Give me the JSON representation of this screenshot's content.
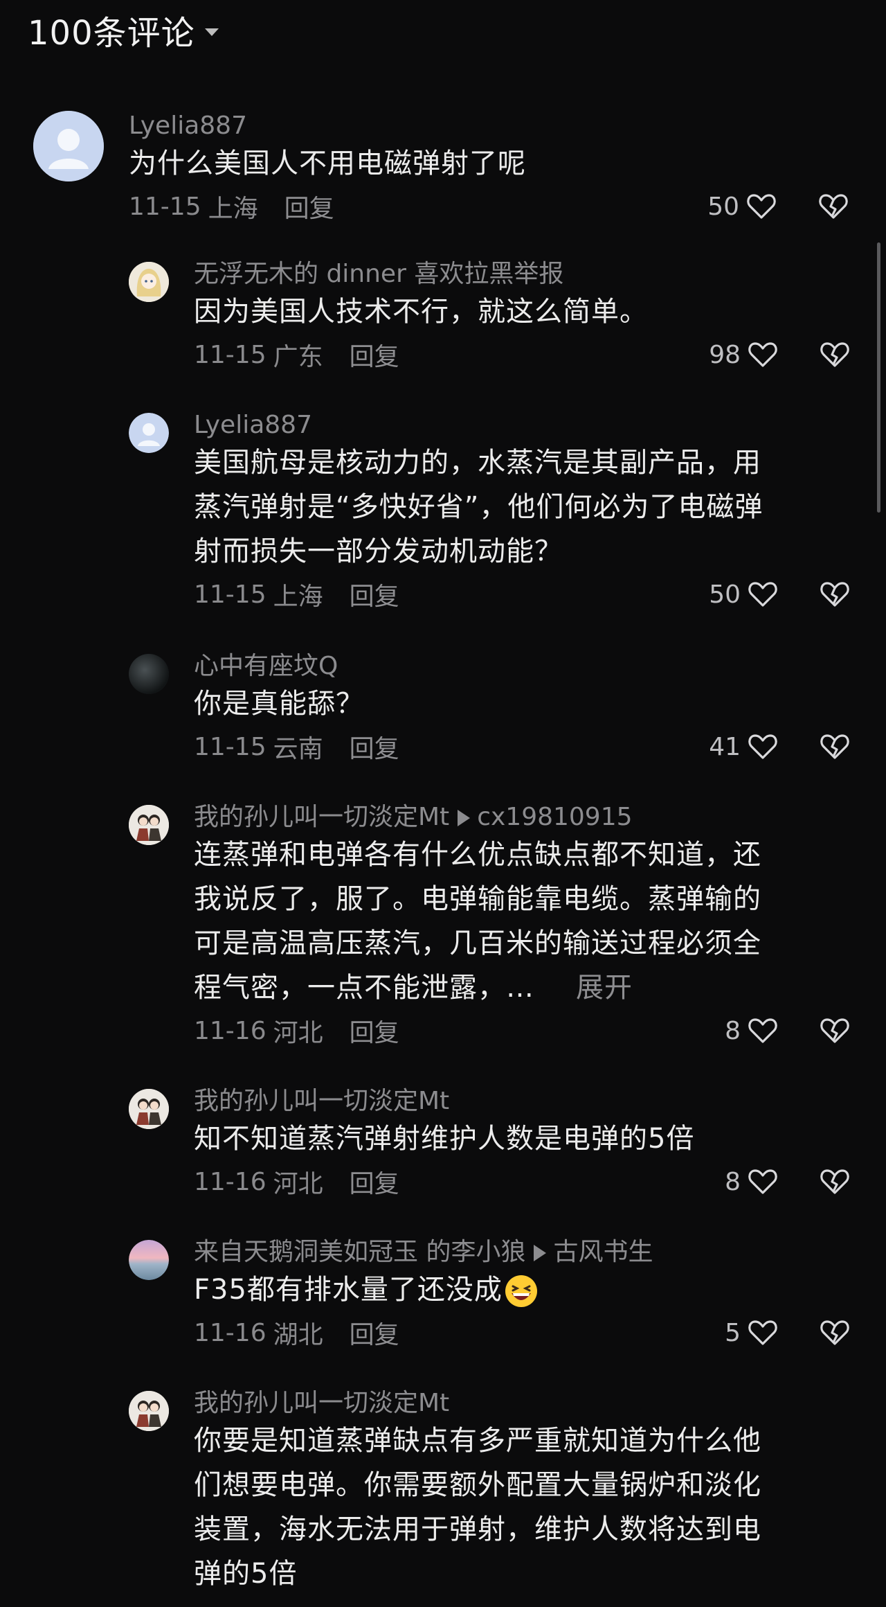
{
  "header": {
    "title": "100条评论"
  },
  "top_comment": {
    "username": "Lyelia887",
    "text": "为什么美国人不用电磁弹射了呢",
    "date": "11-15",
    "location": "上海",
    "reply_label": "回复",
    "likes": "50"
  },
  "replies": [
    {
      "username": "无浮无木的 dinner 喜欢拉黑举报",
      "text": [
        "因为美国人技术不行，就这么简单。"
      ],
      "date": "11-15",
      "location": "广东",
      "reply_label": "回复",
      "likes": "98"
    },
    {
      "username": "Lyelia887",
      "text": [
        "美国航母是核动力的，水蒸汽是其副产品，用",
        "蒸汽弹射是“多快好省”，他们何必为了电磁弹",
        "射而损失一部分发动机动能？"
      ],
      "date": "11-15",
      "location": "上海",
      "reply_label": "回复",
      "likes": "50"
    },
    {
      "username": "心中有座坟Q",
      "text": [
        "你是真能舔？"
      ],
      "date": "11-15",
      "location": "云南",
      "reply_label": "回复",
      "likes": "41"
    },
    {
      "username": "我的孙儿叫一切淡定Mt",
      "reply_to": "cx19810915",
      "text": [
        "连蒸弹和电弹各有什么优点缺点都不知道，还",
        "我说反了，服了。电弹输能靠电缆。蒸弹输的",
        "可是高温高压蒸汽，几百米的输送过程必须全",
        "程气密，一点不能泄露，…"
      ],
      "expand_label": "展开",
      "date": "11-16",
      "location": "河北",
      "reply_label": "回复",
      "likes": "8"
    },
    {
      "username": "我的孙儿叫一切淡定Mt",
      "text": [
        "知不知道蒸汽弹射维护人数是电弹的5倍"
      ],
      "date": "11-16",
      "location": "河北",
      "reply_label": "回复",
      "likes": "8"
    },
    {
      "username": "来自天鹅洞美如冠玉 的李小狼",
      "reply_to": "古风书生",
      "text": [
        "F35都有排水量了还没成"
      ],
      "date": "11-16",
      "location": "湖北",
      "reply_label": "回复",
      "likes": "5"
    },
    {
      "username": "我的孙儿叫一切淡定Mt",
      "text": [
        "你要是知道蒸弹缺点有多严重就知道为什么他",
        "们想要电弹。你需要额外配置大量锅炉和淡化",
        "装置，海水无法用于弹射，维护人数将达到电",
        "弹的5倍"
      ]
    }
  ],
  "icons": {
    "like": "heart-outline-icon",
    "dislike": "broken-heart-outline-icon",
    "caret": "caret-down-icon"
  }
}
